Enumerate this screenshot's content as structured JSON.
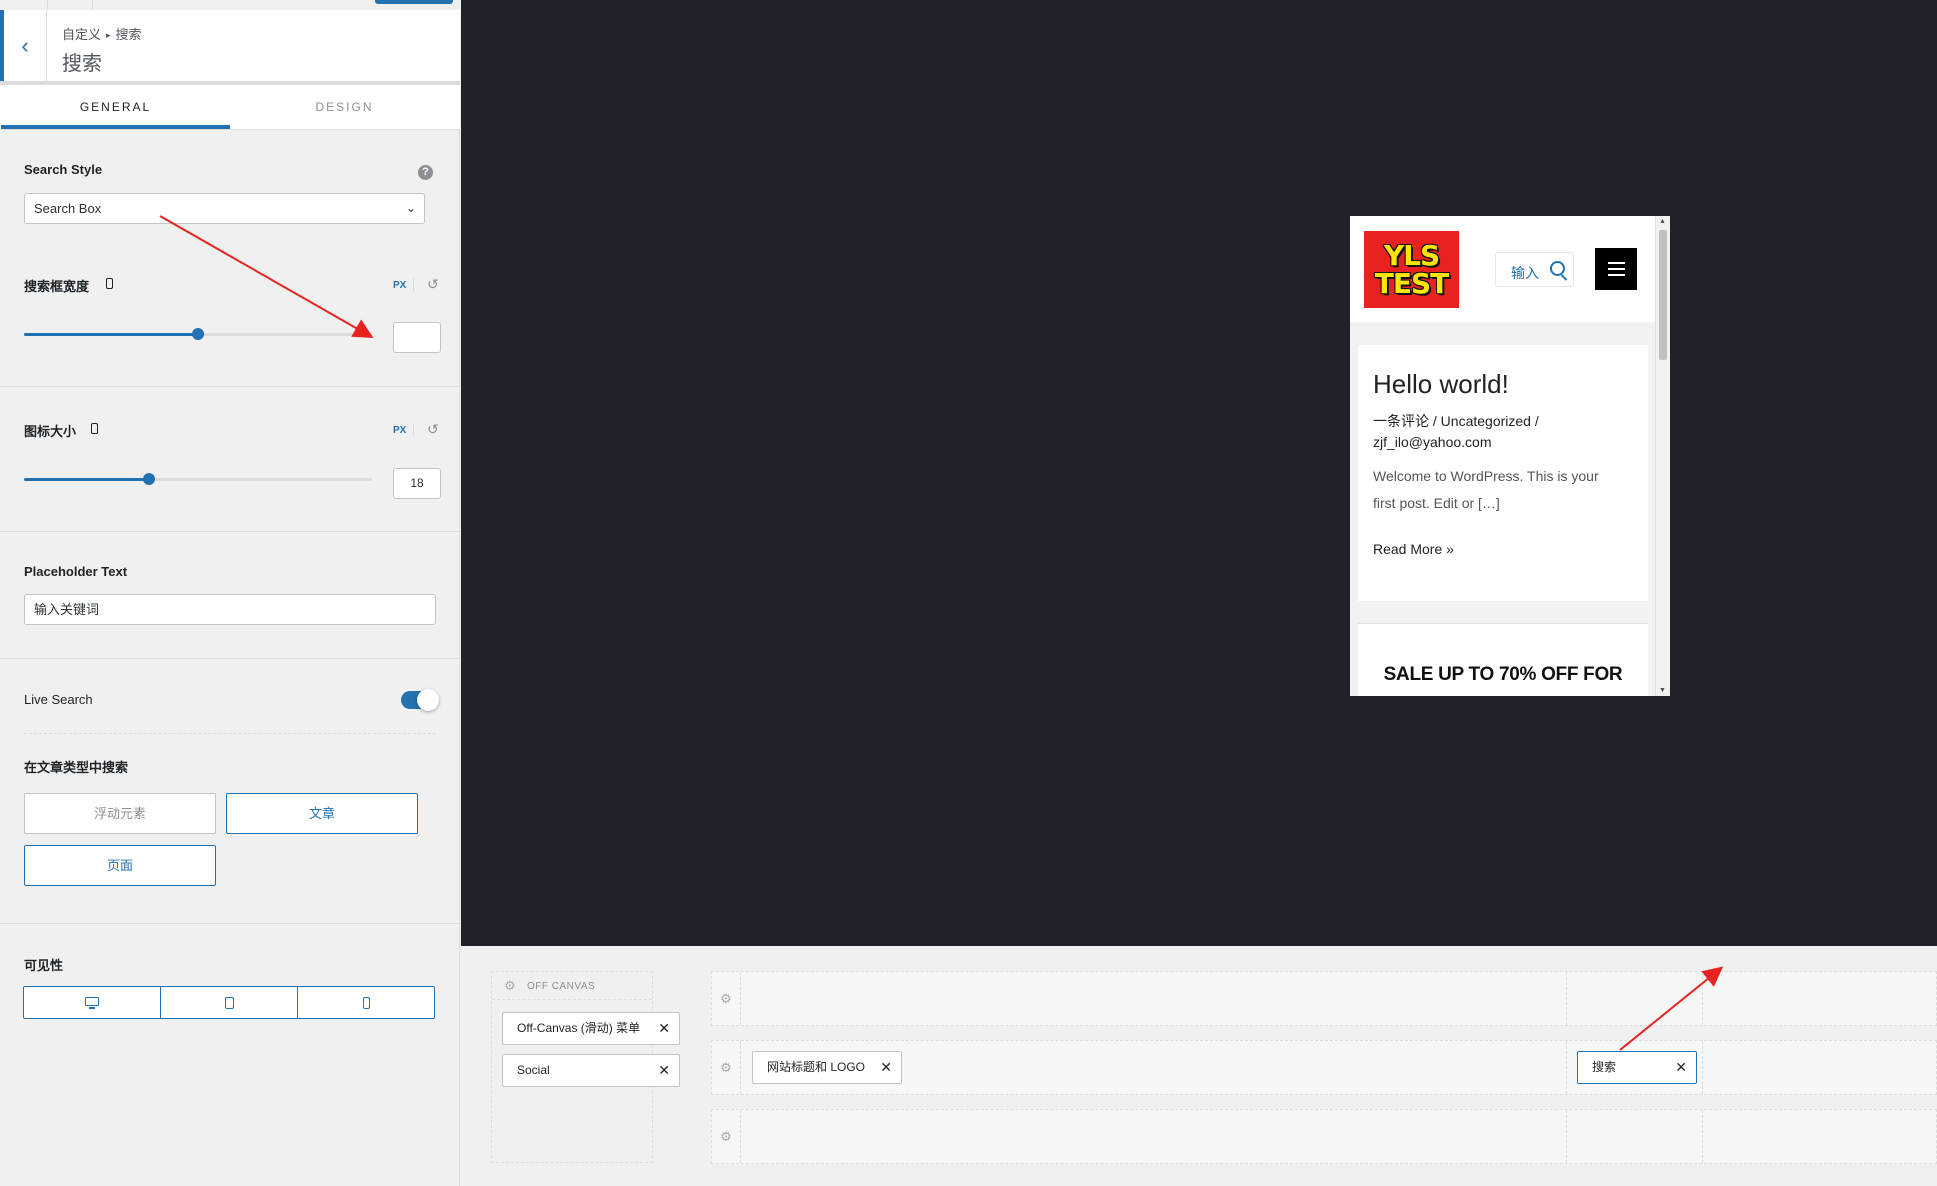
{
  "breadcrumb": {
    "root": "自定义",
    "current": "搜索"
  },
  "section_title": "搜索",
  "tabs": [
    {
      "label": "GENERAL"
    },
    {
      "label": "DESIGN"
    }
  ],
  "search_style": {
    "label": "Search Style",
    "help": "?",
    "value": "Search Box"
  },
  "search_width": {
    "label": "搜索框宽度",
    "unit": "PX",
    "value": "",
    "slider_percent": 50
  },
  "icon_size": {
    "label": "图标大小",
    "unit": "PX",
    "value": "18",
    "slider_percent": 36
  },
  "placeholder_text": {
    "label": "Placeholder Text",
    "value": "输入关键词"
  },
  "live_search": {
    "label": "Live Search",
    "enabled": true
  },
  "post_types": {
    "label": "在文章类型中搜索",
    "options": [
      {
        "label": "浮动元素",
        "selected": false
      },
      {
        "label": "文章",
        "selected": true
      },
      {
        "label": "页面",
        "selected": true
      }
    ]
  },
  "visibility": {
    "label": "可见性",
    "devices": [
      "desktop-icon",
      "tablet-icon",
      "mobile-icon"
    ]
  },
  "preview": {
    "header_search_text": "输入",
    "logo_lines": [
      "YLS",
      "TEST"
    ],
    "post": {
      "title": "Hello world!",
      "meta": "一条评论 / Uncategorized / zjf_ilo@yahoo.com",
      "excerpt": "Welcome to WordPress. This is your first post. Edit or […]",
      "read_more": "Read More »"
    },
    "sale_text": "SALE UP TO 70% OFF FOR"
  },
  "builder": {
    "off_canvas_label": "OFF CANVAS",
    "off_canvas_items": [
      "Off-Canvas (滑动) 菜单",
      "Social"
    ],
    "main_row_items": [
      "网站标题和 LOGO"
    ],
    "search_item": "搜索"
  },
  "colors": {
    "accent": "#2271b1",
    "preview_bg": "#1f2228",
    "annotation": "#e8231f"
  }
}
